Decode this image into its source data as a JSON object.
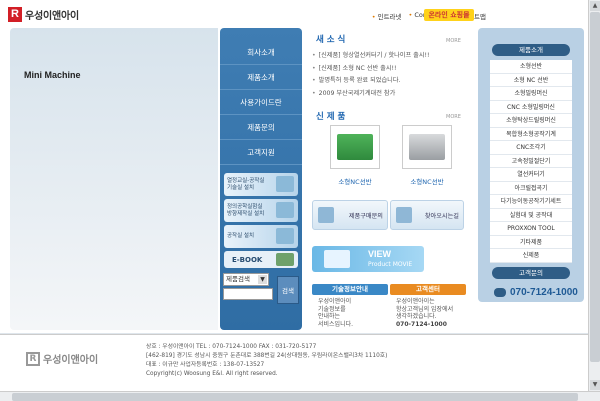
{
  "header": {
    "logo_mark": "R",
    "logo_text": "우성이앤아이",
    "nav": [
      "인트라넷",
      "Contact us",
      "사이트맵"
    ],
    "online_shop": "온라인 쇼핑몰"
  },
  "hero": {
    "title": "Mini Machine"
  },
  "menu": {
    "items": [
      "회사소개",
      "제품소개",
      "사용가이드란",
      "제품문의",
      "고객지원"
    ],
    "promo1": [
      "열정교실-공작실",
      "기술실 설치"
    ],
    "promo2": [
      "정의공학실험실",
      "방향제작실 설치"
    ],
    "promo3": "공작실 설치",
    "ebook": "E-BOOK",
    "search_select": "제품검색",
    "search_button": "검색"
  },
  "news": {
    "title": "새 소 식",
    "more": "MORE",
    "items": [
      "[신제품] 형상열선커터기 / 핫나이프 출시!!",
      "[신제품] 소형 NC 선반 출시!!",
      "발명특허 등록 완료 되었습니다.",
      "2009 부산국제기계대전 참가"
    ]
  },
  "products": {
    "title": "신 제 품",
    "more": "MORE",
    "items": [
      "소형NC선반",
      "소형NC선반"
    ]
  },
  "quick": {
    "inquiry": "제품구매문의",
    "directions": "찾아오시는길"
  },
  "movie": {
    "line1": "VIEW",
    "line2": "Product MOVIE"
  },
  "info1": {
    "head": "기술정보안내",
    "body": [
      "우성이앤아이",
      "기술정보를",
      "안내하는",
      "서비스입니다."
    ]
  },
  "info2": {
    "head": "고객센터",
    "body": [
      "우성이앤아이는",
      "항상고객님의 입장에서",
      "생각하겠습니다."
    ],
    "phone": "070-7124-1000"
  },
  "sidebar": {
    "head": "제품소개",
    "items": [
      "소형선반",
      "소형 NC 선반",
      "소형밀링머신",
      "CNC 소형밀링머신",
      "소형탁상드릴링머신",
      "복합형소형공작기계",
      "CNC조각기",
      "고속정밀절단기",
      "열선커터기",
      "아크릴접곡기",
      "다기능이동공작기기세트",
      "실험대 및 공작대",
      "PROXXON TOOL",
      "기타제품",
      "신제품"
    ],
    "head2": "고객문의",
    "phone": "070-7124-1000"
  },
  "footer": {
    "logo_mark": "R",
    "logo_text": "우성이앤아이",
    "lines": [
      "상호 : 우성이앤아이   TEL : 070-7124-1000   FAX : 031-720-5177",
      "[462-819] 경기도 성남시 중원구 둔촌대로 388번길 24(상대원동, 우림라이온스밸리3차 1110호)",
      "대표 : 이규만        사업자등록번호 : 138-07-13527",
      "Copyright(c) Woosung E&I. All right reserved."
    ]
  }
}
